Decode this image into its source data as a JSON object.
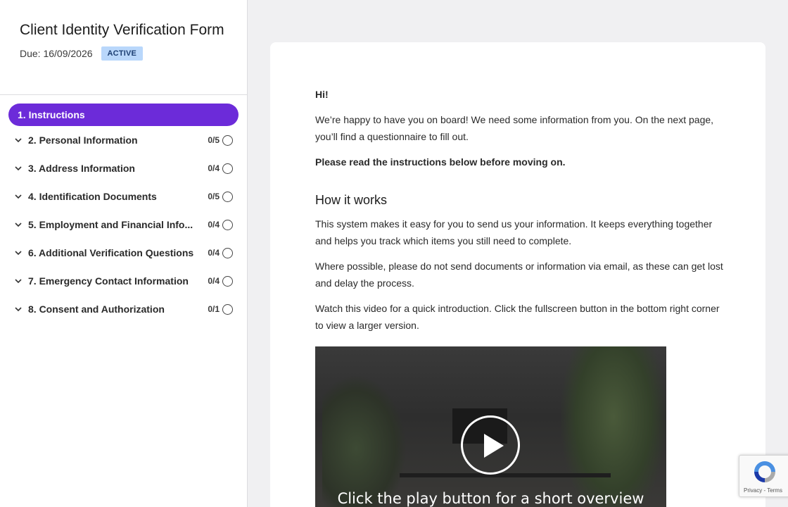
{
  "sidebar": {
    "form_title": "Client Identity Verification Form",
    "due": "Due: 16/09/2026",
    "status_badge": "ACTIVE",
    "active_item": "1. Instructions",
    "items": [
      {
        "label": "2. Personal Information",
        "count": "0/5"
      },
      {
        "label": "3. Address Information",
        "count": "0/4"
      },
      {
        "label": "4. Identification Documents",
        "count": "0/5"
      },
      {
        "label": "5. Employment and Financial Info...",
        "count": "0/4"
      },
      {
        "label": "6. Additional Verification Questions",
        "count": "0/4"
      },
      {
        "label": "7. Emergency Contact Information",
        "count": "0/4"
      },
      {
        "label": "8. Consent and Authorization",
        "count": "0/1"
      }
    ]
  },
  "content": {
    "greeting": "Hi!",
    "intro": "We’re happy to have you on board! We need some information from you. On the next page, you’ll find a questionnaire to fill out.",
    "notice": "Please read the instructions below before moving on.",
    "heading": "How it works",
    "para1": "This system makes it easy for you to send us your information. It keeps everything together and helps you track which items you still need to complete.",
    "para2": "Where possible, please do not send documents or information via email, as these can get lost and delay the process.",
    "para3": "Watch this video for a quick introduction. Click the fullscreen button in the bottom right corner to view a larger version.",
    "video_caption": "Click the play button for a short overview"
  },
  "recaptcha": {
    "text": "Privacy - Terms"
  },
  "colors": {
    "accent": "#6c2bd9",
    "badge_bg": "#b9d7fb",
    "page_bg": "#f0f0f2"
  }
}
